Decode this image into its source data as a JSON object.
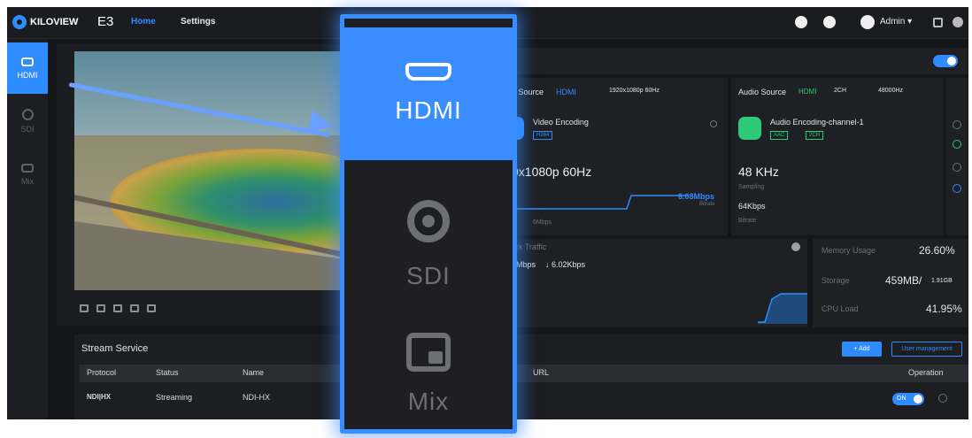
{
  "app": {
    "brand": "KILOVIEW",
    "model": "E3"
  },
  "nav": {
    "home": "Home",
    "settings": "Settings",
    "user": "Admin ▾"
  },
  "sidebar": {
    "items": [
      {
        "label": "HDMI",
        "icon": "hdmi-icon",
        "active": true
      },
      {
        "label": "SDI",
        "icon": "sdi-icon",
        "active": false
      },
      {
        "label": "Mix",
        "icon": "mix-icon",
        "active": false
      }
    ]
  },
  "video_source": {
    "label": "o Source",
    "type": "HDMI",
    "format": "1920x1080p 60Hz"
  },
  "audio_source": {
    "label": "Audio Source",
    "type": "HDMI",
    "channels": "2CH",
    "rate": "48000Hz"
  },
  "video_encoding": {
    "title": "Video Encoding",
    "codec": "H264",
    "resolution": "0x1080p 60Hz",
    "bitrate": "6.08Mbps",
    "bitrate_caption": "Bitrate",
    "small_value": "6Mbps"
  },
  "audio_encoding": {
    "title": "Audio Encoding-channel-1",
    "codec": "AAC",
    "channels": "2CH",
    "sampling": "48 KHz",
    "sampling_caption": "Sampling",
    "bitrate": "64Kbps",
    "bitrate_caption": "Bitrate"
  },
  "network": {
    "title": "ork Traffic",
    "up": "3Mbps",
    "down": "↓ 6.02Kbps"
  },
  "stats": {
    "memory_label": "Memory Usage",
    "memory_value": "26.60%",
    "storage_label": "Storage",
    "storage_value": "459MB/",
    "storage_total": "1.91GB",
    "cpu_label": "CPU Load",
    "cpu_value": "41.95%"
  },
  "actions": {
    "add": "+ Add",
    "user_management": "User management"
  },
  "stream": {
    "title": "Stream Service",
    "columns": [
      "Protocol",
      "Status",
      "Name",
      "URL",
      "Operation"
    ],
    "rows": [
      {
        "protocol": "NDI|HX",
        "status": "Streaming",
        "name": "NDI-HX",
        "toggle": "ON"
      }
    ]
  },
  "zoom": {
    "items": [
      {
        "label": "HDMI",
        "active": true
      },
      {
        "label": "SDI",
        "active": false
      },
      {
        "label": "Mix",
        "active": false
      }
    ]
  },
  "colors": {
    "accent": "#2f8cff",
    "success": "#2fc97a",
    "background": "#14161a"
  }
}
